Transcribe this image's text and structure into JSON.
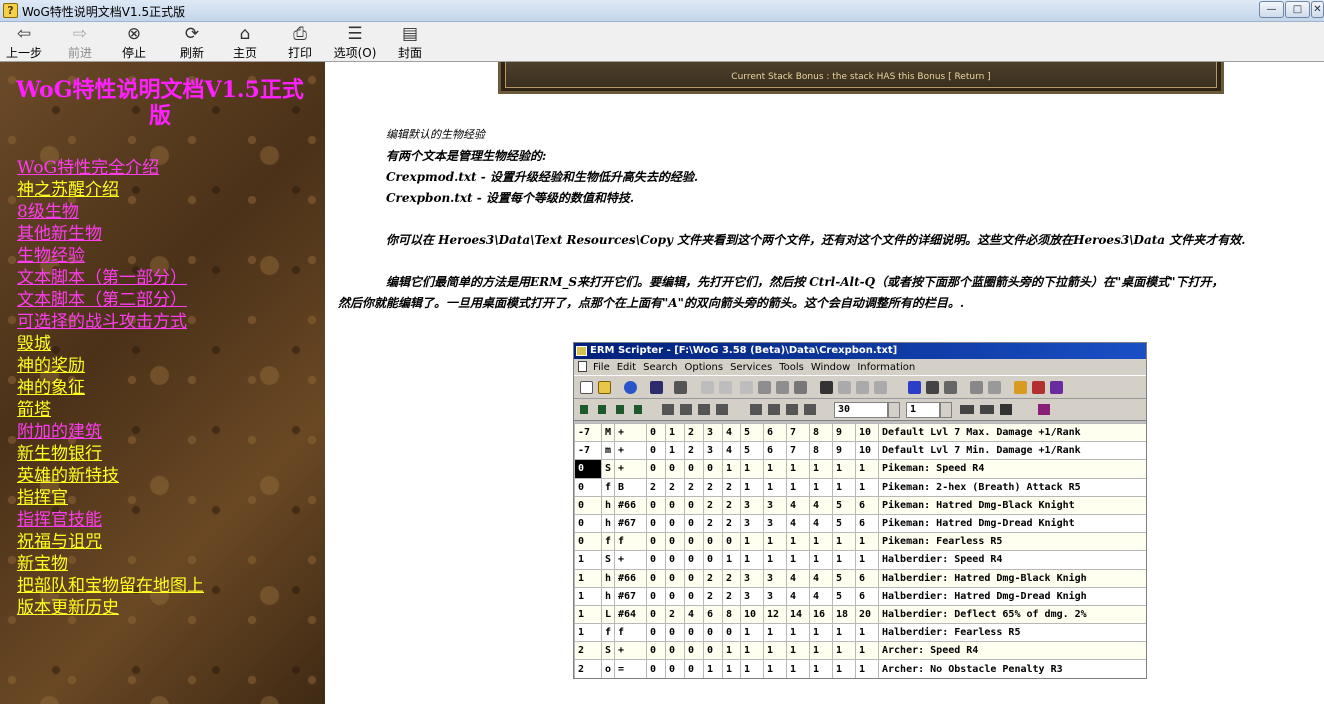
{
  "window": {
    "title": "WoG特性说明文档V1.5正式版",
    "controls": [
      "—",
      "□",
      "✕"
    ]
  },
  "toolbar": [
    {
      "label": "上一步",
      "icon": "back-arrow-icon",
      "glyph": "⇦",
      "enabled": true
    },
    {
      "label": "前进",
      "icon": "forward-arrow-icon",
      "glyph": "⇨",
      "enabled": false
    },
    {
      "label": "停止",
      "icon": "stop-icon",
      "glyph": "⊗",
      "enabled": true
    },
    {
      "label": "刷新",
      "icon": "refresh-icon",
      "glyph": "⟳",
      "enabled": true
    },
    {
      "label": "主页",
      "icon": "home-icon",
      "glyph": "⌂",
      "enabled": true
    },
    {
      "label": "打印",
      "icon": "print-icon",
      "glyph": "⎙",
      "enabled": true
    },
    {
      "label": "选项(O)",
      "icon": "options-icon",
      "glyph": "☰",
      "enabled": true
    },
    {
      "label": "封面",
      "icon": "cover-icon",
      "glyph": "▤",
      "enabled": true
    }
  ],
  "sidebar": {
    "heading": "WoG特性说明文档V1.5正式版",
    "links": [
      {
        "label": "WoG特性完全介绍",
        "visited": true
      },
      {
        "label": "神之苏醒介绍",
        "visited": false
      },
      {
        "label": "8级生物",
        "visited": true
      },
      {
        "label": "其他新生物",
        "visited": true
      },
      {
        "label": "生物经验",
        "visited": true
      },
      {
        "label": "文本脚本（第一部分）",
        "visited": true
      },
      {
        "label": "文本脚本（第二部分）",
        "visited": true
      },
      {
        "label": "可选择的战斗攻击方式",
        "visited": true
      },
      {
        "label": "毁城",
        "visited": false
      },
      {
        "label": "神的奖励",
        "visited": false
      },
      {
        "label": "神的象征",
        "visited": false
      },
      {
        "label": "箭塔",
        "visited": false
      },
      {
        "label": "附加的建筑",
        "visited": true
      },
      {
        "label": "新生物银行",
        "visited": false
      },
      {
        "label": "英雄的新特技",
        "visited": false
      },
      {
        "label": "指挥官",
        "visited": false
      },
      {
        "label": "指挥官技能",
        "visited": true
      },
      {
        "label": "祝福与诅咒",
        "visited": false
      },
      {
        "label": "新宝物",
        "visited": false
      },
      {
        "label": "把部队和宝物留在地图上",
        "visited": false
      },
      {
        "label": "版本更新历史",
        "visited": false
      }
    ]
  },
  "content": {
    "banner_text": "Current Stack Bonus : the stack HAS this Bonus [ Return ]",
    "p1": "编辑默认的生物经验",
    "p2": "有两个文本是管理生物经验的:",
    "p3": "Crexpmod.txt - 设置升级经验和生物低升高失去的经验.",
    "p4": "Crexpbon.txt - 设置每个等级的数值和特技.",
    "p5": "你可以在 Heroes3\\Data\\Text Resources\\Copy 文件夹看到这个两个文件，还有对这个文件的详细说明。这些文件必须放在Heroes3\\Data 文件夹才有效.",
    "p6a": "编辑它们最简单的方法是用ERM_S来打开它们。要编辑，先打开它们，然后按 Ctrl-Alt-Q（或者按下面那个蓝圈箭头旁的下拉箭头）在\"桌面模式\"下打开，",
    "p6b": "然后你就能编辑了。一旦用桌面模式打开了，点那个在上面有\"A\"的双向箭头旁的箭头。这个会自动调整所有的栏目。."
  },
  "erm": {
    "title": "ERM Scripter - [F:\\WoG 3.58 (Beta)\\Data\\Crexpbon.txt]",
    "menu": [
      "File",
      "Edit",
      "Search",
      "Options",
      "Services",
      "Tools",
      "Window",
      "Information"
    ],
    "tabsize": "30",
    "spin": "1",
    "rows": [
      [
        "-7",
        "M",
        "+",
        "0",
        "1",
        "2",
        "3",
        "4",
        "5",
        "6",
        "7",
        "8",
        "9",
        "10",
        "Default Lvl 7 Max. Damage +1/Rank"
      ],
      [
        "-7",
        "m",
        "+",
        "0",
        "1",
        "2",
        "3",
        "4",
        "5",
        "6",
        "7",
        "8",
        "9",
        "10",
        "Default Lvl 7 Min. Damage +1/Rank"
      ],
      [
        "0",
        "S",
        "+",
        "0",
        "0",
        "0",
        "0",
        "1",
        "1",
        "1",
        "1",
        "1",
        "1",
        "1",
        "Pikeman: Speed R4"
      ],
      [
        "0",
        "f",
        "B",
        "2",
        "2",
        "2",
        "2",
        "2",
        "1",
        "1",
        "1",
        "1",
        "1",
        "1",
        "Pikeman: 2-hex (Breath) Attack R5"
      ],
      [
        "0",
        "h",
        "#66",
        "0",
        "0",
        "0",
        "2",
        "2",
        "3",
        "3",
        "4",
        "4",
        "5",
        "6",
        "Pikeman: Hatred Dmg-Black Knight"
      ],
      [
        "0",
        "h",
        "#67",
        "0",
        "0",
        "0",
        "2",
        "2",
        "3",
        "3",
        "4",
        "4",
        "5",
        "6",
        "Pikeman: Hatred Dmg-Dread Knight"
      ],
      [
        "0",
        "f",
        "f",
        "0",
        "0",
        "0",
        "0",
        "0",
        "1",
        "1",
        "1",
        "1",
        "1",
        "1",
        "Pikeman: Fearless R5"
      ],
      [
        "1",
        "S",
        "+",
        "0",
        "0",
        "0",
        "0",
        "1",
        "1",
        "1",
        "1",
        "1",
        "1",
        "1",
        "Halberdier: Speed R4"
      ],
      [
        "1",
        "h",
        "#66",
        "0",
        "0",
        "0",
        "2",
        "2",
        "3",
        "3",
        "4",
        "4",
        "5",
        "6",
        "Halberdier: Hatred Dmg-Black Knigh"
      ],
      [
        "1",
        "h",
        "#67",
        "0",
        "0",
        "0",
        "2",
        "2",
        "3",
        "3",
        "4",
        "4",
        "5",
        "6",
        "Halberdier: Hatred Dmg-Dread Knigh"
      ],
      [
        "1",
        "L",
        "#64",
        "0",
        "2",
        "4",
        "6",
        "8",
        "10",
        "12",
        "14",
        "16",
        "18",
        "20",
        "Halberdier: Deflect 65% of dmg. 2%"
      ],
      [
        "1",
        "f",
        "f",
        "0",
        "0",
        "0",
        "0",
        "0",
        "1",
        "1",
        "1",
        "1",
        "1",
        "1",
        "Halberdier: Fearless R5"
      ],
      [
        "2",
        "S",
        "+",
        "0",
        "0",
        "0",
        "0",
        "1",
        "1",
        "1",
        "1",
        "1",
        "1",
        "1",
        "Archer: Speed R4"
      ],
      [
        "2",
        "o",
        "=",
        "0",
        "0",
        "0",
        "1",
        "1",
        "1",
        "1",
        "1",
        "1",
        "1",
        "1",
        "Archer: No Obstacle Penalty R3"
      ]
    ]
  }
}
